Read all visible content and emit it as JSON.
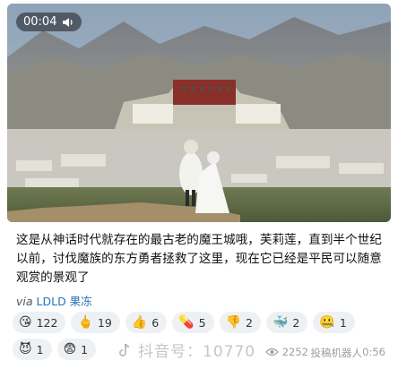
{
  "media": {
    "timer": "00:04",
    "volume_icon": "speaker-icon"
  },
  "caption": {
    "text": "这是从神话时代就存在的最古老的魔王城哦，芙莉莲，直到半个世纪以前，讨伐魔族的东方勇者拯救了这里，现在它已经是平民可以随意观赏的景观了"
  },
  "via": {
    "label": "via",
    "name": "LDLD 果冻"
  },
  "reactions": [
    {
      "emoji": "😘",
      "count": "122"
    },
    {
      "emoji": "🖕",
      "count": "19"
    },
    {
      "emoji": "👍",
      "count": "6"
    },
    {
      "emoji": "💊",
      "count": "5"
    },
    {
      "emoji": "👎",
      "count": "2"
    },
    {
      "emoji": "🐳",
      "count": "2"
    },
    {
      "emoji": "🤐",
      "count": "1"
    },
    {
      "emoji": "😈",
      "count": "1"
    },
    {
      "emoji": "😨",
      "count": "1"
    }
  ],
  "footer": {
    "views": "2252",
    "author": "投稿机器人",
    "time": "0:56"
  },
  "watermark": {
    "text": "抖音号：10770"
  }
}
